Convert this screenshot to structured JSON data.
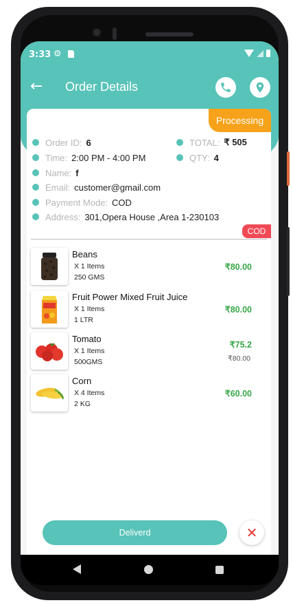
{
  "status_bar": {
    "time": "3:33"
  },
  "app_bar": {
    "title": "Order Details"
  },
  "order": {
    "status": "Processing",
    "payment_badge": "COD",
    "fields": {
      "order_id_label": "Order ID:",
      "order_id": "6",
      "total_label": "TOTAL:",
      "total": "₹ 505",
      "time_label": "Time:",
      "time": "2:00 PM - 4:00 PM",
      "qty_label": "QTY:",
      "qty": "4",
      "name_label": "Name:",
      "name": "f",
      "email_label": "Email:",
      "email": "customer@gmail.com",
      "payment_label": "Payment Mode:",
      "payment": "COD",
      "address_label": "Address:",
      "address": "301,Opera House ,Area 1-230103"
    }
  },
  "items": [
    {
      "name": "Beans",
      "qty": "X 1 Items",
      "unit": "250 GMS",
      "price": "₹80.00",
      "old_price": ""
    },
    {
      "name": "Fruit Power Mixed Fruit Juice",
      "qty": "X 1 Items",
      "unit": "1 LTR",
      "price": "₹80.00",
      "old_price": ""
    },
    {
      "name": "Tomato",
      "qty": "X 1 Items",
      "unit": "500GMS",
      "price": "₹75.2",
      "old_price": "₹80.00"
    },
    {
      "name": "Corn",
      "qty": "X 4 Items",
      "unit": "2 KG",
      "price": "₹60.00",
      "old_price": ""
    }
  ],
  "actions": {
    "deliver_label": "Deliverd",
    "cancel_icon": "close-icon"
  },
  "colors": {
    "teal": "#58c3b8",
    "orange": "#f7a21b",
    "red": "#f04a57",
    "green": "#3aa84a"
  }
}
